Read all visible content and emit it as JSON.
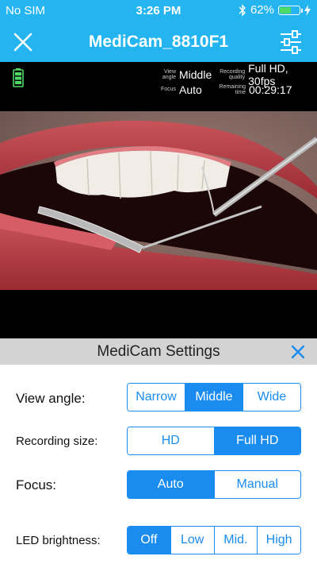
{
  "status_bar": {
    "carrier": "No SIM",
    "time": "3:26 PM",
    "battery_percent_text": "62%",
    "battery_level": 0.62
  },
  "nav": {
    "title": "MediCam_8810F1"
  },
  "camera_info": {
    "view_angle_label": "View angle",
    "view_angle_value": "Middle",
    "focus_label": "Focus",
    "focus_value": "Auto",
    "recording_quality_label": "Recording quality",
    "recording_quality_value": "Full HD, 30fps",
    "remaining_time_label": "Remaining time",
    "remaining_time_value": "00:29:17"
  },
  "settings": {
    "title": "MediCam Settings",
    "view_angle": {
      "label": "View angle:",
      "options": [
        "Narrow",
        "Middle",
        "Wide"
      ],
      "selected": "Middle"
    },
    "recording_size": {
      "label": "Recording size:",
      "options": [
        "HD",
        "Full HD"
      ],
      "selected": "Full HD"
    },
    "focus": {
      "label": "Focus:",
      "options": [
        "Auto",
        "Manual"
      ],
      "selected": "Auto"
    },
    "led_brightness": {
      "label": "LED brightness:",
      "options": [
        "Off",
        "Low",
        "Mid.",
        "High"
      ],
      "selected": "Off"
    }
  },
  "colors": {
    "header_blue": "#24b5f0",
    "accent_blue": "#1a8cf0",
    "battery_green": "#4cd964"
  },
  "icons": {
    "close": "close-icon",
    "settings": "sliders-icon",
    "bluetooth": "bluetooth-icon",
    "charging": "lightning-icon",
    "camera_battery": "battery-icon"
  }
}
